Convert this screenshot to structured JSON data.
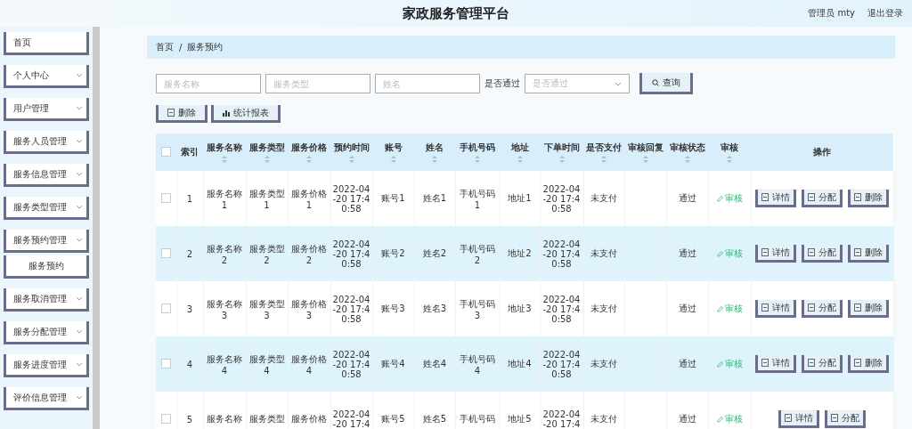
{
  "header": {
    "title": "家政服务管理平台",
    "user": "管理员 mty",
    "logout": "退出登录"
  },
  "sidebar": {
    "items": [
      {
        "label": "首页",
        "kind": "link"
      },
      {
        "label": "个人中心",
        "kind": "menu"
      },
      {
        "label": "用户管理",
        "kind": "menu"
      },
      {
        "label": "服务人员管理",
        "kind": "menu"
      },
      {
        "label": "服务信息管理",
        "kind": "menu"
      },
      {
        "label": "服务类型管理",
        "kind": "menu"
      },
      {
        "label": "服务预约管理",
        "kind": "menu",
        "children": [
          {
            "label": "服务预约"
          }
        ]
      },
      {
        "label": "服务取消管理",
        "kind": "menu"
      },
      {
        "label": "服务分配管理",
        "kind": "menu"
      },
      {
        "label": "服务进度管理",
        "kind": "menu"
      },
      {
        "label": "评价信息管理",
        "kind": "menu"
      }
    ]
  },
  "breadcrumb": {
    "items": [
      "首页",
      "服务预约"
    ],
    "separator": "/"
  },
  "search": {
    "fields": [
      {
        "placeholder": "服务名称"
      },
      {
        "placeholder": "服务类型"
      },
      {
        "placeholder": "姓名"
      }
    ],
    "select_label": "是否通过",
    "select_placeholder": "是否通过",
    "button": "查询"
  },
  "toolbar": [
    {
      "label": "删除",
      "kind": "delete"
    },
    {
      "label": "统计报表",
      "kind": "chart"
    }
  ],
  "table": {
    "select_all": {
      "checked": false
    },
    "columns": [
      {
        "label": "索引",
        "sortable": false
      },
      {
        "label": "服务名称",
        "sortable": true
      },
      {
        "label": "服务类型",
        "sortable": true
      },
      {
        "label": "服务价格",
        "sortable": true
      },
      {
        "label": "预约时间",
        "sortable": true
      },
      {
        "label": "账号",
        "sortable": true
      },
      {
        "label": "姓名",
        "sortable": true
      },
      {
        "label": "手机号码",
        "sortable": true
      },
      {
        "label": "地址",
        "sortable": true
      },
      {
        "label": "下单时间",
        "sortable": true
      },
      {
        "label": "是否支付",
        "sortable": true
      },
      {
        "label": "审核回复",
        "sortable": true
      },
      {
        "label": "审核状态",
        "sortable": true
      },
      {
        "label": "审核",
        "sortable": true
      },
      {
        "label": "操作",
        "sortable": false
      }
    ],
    "rows": [
      {
        "checked": false,
        "cells": [
          "1",
          "服务名称1",
          "服务类型1",
          "服务价格1",
          "2022-04-20 17:40:58",
          "账号1",
          "姓名1",
          "手机号码1",
          "地址1",
          "2022-04-20 17:40:58",
          "未支付",
          null,
          "通过"
        ],
        "review": "审核",
        "actions": [
          "详情",
          "分配",
          "删除"
        ]
      },
      {
        "checked": false,
        "cells": [
          "2",
          "服务名称2",
          "服务类型2",
          "服务价格2",
          "2022-04-20 17:40:58",
          "账号2",
          "姓名2",
          "手机号码2",
          "地址2",
          "2022-04-20 17:40:58",
          "未支付",
          null,
          "通过"
        ],
        "review": "审核",
        "actions": [
          "详情",
          "分配",
          "删除"
        ]
      },
      {
        "checked": false,
        "cells": [
          "3",
          "服务名称3",
          "服务类型3",
          "服务价格3",
          "2022-04-20 17:40:58",
          "账号3",
          "姓名3",
          "手机号码3",
          "地址3",
          "2022-04-20 17:40:58",
          "未支付",
          null,
          "通过"
        ],
        "review": "审核",
        "actions": [
          "详情",
          "分配",
          "删除"
        ]
      },
      {
        "checked": false,
        "cells": [
          "4",
          "服务名称4",
          "服务类型4",
          "服务价格4",
          "2022-04-20 17:40:58",
          "账号4",
          "姓名4",
          "手机号码4",
          "地址4",
          "2022-04-20 17:40:58",
          "未支付",
          null,
          "通过"
        ],
        "review": "审核",
        "actions": [
          "详情",
          "分配",
          "删除"
        ]
      },
      {
        "checked": false,
        "cells": [
          "5",
          "服务名称",
          "服务类型",
          "服务价格",
          "2022-04-20 17:4",
          "账号5",
          "姓名5",
          "手机号码",
          "地址5",
          "2022-04-20 17:4",
          "未支付",
          null,
          "通过"
        ],
        "review": "审核",
        "actions": [
          "详情",
          "分配"
        ]
      }
    ]
  }
}
